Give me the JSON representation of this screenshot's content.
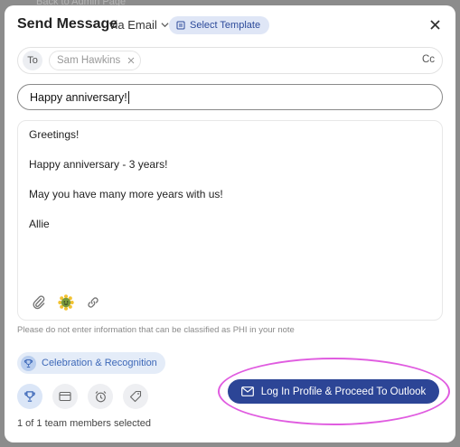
{
  "background": {
    "text": "Back to Admin Page"
  },
  "header": {
    "title": "Send Message",
    "channel": "via Email",
    "template_button": "Select Template",
    "close_icon": "close-icon"
  },
  "recipients": {
    "to_label": "To",
    "chips": [
      "Sam Hawkins"
    ],
    "cc_label": "Cc"
  },
  "subject": {
    "value": "Happy anniversary!"
  },
  "message": {
    "lines": [
      "Greetings!",
      "Happy anniversary - 3 years!",
      "May you have many more years with us!",
      "Allie"
    ]
  },
  "toolbar": {
    "icons": [
      "paperclip-icon",
      "sunflower-emoji-icon",
      "link-icon"
    ]
  },
  "disclaimer": "Please do not enter information that can be classified as PHI in your note",
  "category": {
    "label": "Celebration & Recognition",
    "icon": "trophy-icon"
  },
  "category_icons": [
    "trophy-icon",
    "card-icon",
    "alarm-clock-icon",
    "tag-icon"
  ],
  "selection": {
    "text": "1 of 1 team members selected"
  },
  "cta": {
    "label": "Log In Profile & Proceed To Outlook",
    "icon": "envelope-icon"
  },
  "colors": {
    "primary": "#2c4596",
    "accent_light": "#dfe6f6",
    "highlight_ring": "#e05ce0"
  }
}
